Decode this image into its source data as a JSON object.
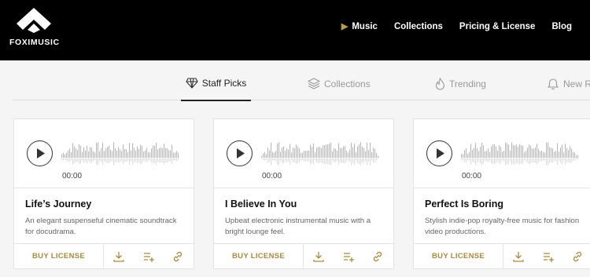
{
  "brand": {
    "name": "FOXIMUSIC"
  },
  "nav": {
    "items": [
      {
        "label": "Music",
        "active": true
      },
      {
        "label": "Collections"
      },
      {
        "label": "Pricing & License"
      },
      {
        "label": "Blog"
      }
    ]
  },
  "tabs": [
    {
      "label": "Staff Picks",
      "icon": "tag-icon",
      "active": true
    },
    {
      "label": "Collections",
      "icon": "layers-icon"
    },
    {
      "label": "Trending",
      "icon": "flame-icon"
    },
    {
      "label": "New R",
      "icon": "bell-icon"
    }
  ],
  "tracks": [
    {
      "title": "Life’s Journey",
      "description": "An elegant suspenseful cinematic soundtrack for docudrama.",
      "time": "00:00",
      "buy_label": "BUY LICENSE"
    },
    {
      "title": "I Believe In You",
      "description": "Upbeat electronic instrumental music with a bright lounge feel.",
      "time": "00:00",
      "buy_label": "BUY LICENSE"
    },
    {
      "title": "Perfect Is Boring",
      "description": "Stylish indie-pop royalty-free music for fashion video productions.",
      "time": "00:00",
      "buy_label": "BUY LICENSE"
    }
  ],
  "colors": {
    "accent": "#a68a3e",
    "header_bg": "#000000",
    "page_bg": "#f5f5f5"
  }
}
